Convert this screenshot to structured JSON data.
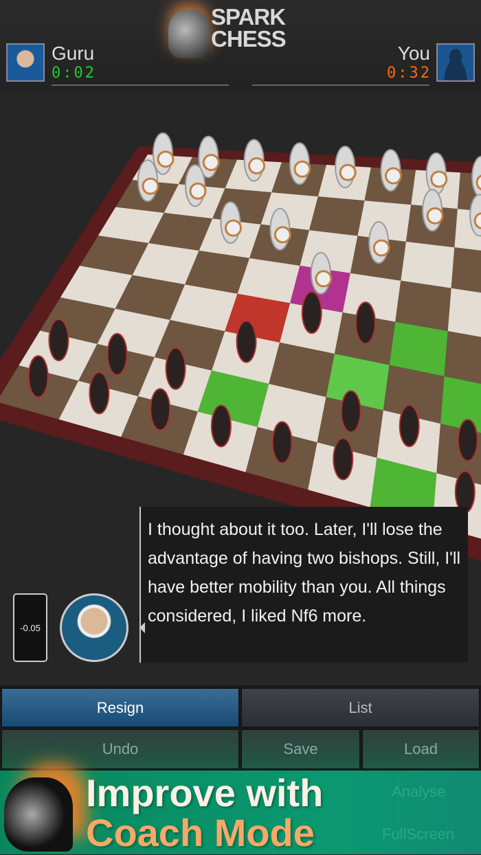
{
  "header": {
    "logo": "SPARK CHESS",
    "logo_line1": "SPARK",
    "logo_line2": "CHESS",
    "player_left": {
      "name": "Guru",
      "clock": "0:02",
      "clock_color": "#22cc22"
    },
    "player_right": {
      "name": "You",
      "clock": "0:32",
      "clock_color": "#ff6a10"
    }
  },
  "board": {
    "light": "#e3ddd3",
    "dark": "#6e5640",
    "frame": "#5a1c1c",
    "highlights": [
      {
        "sq": "d4",
        "color": "#c0362a"
      },
      {
        "sq": "e5",
        "color": "#b0348f"
      },
      {
        "sq": "g4",
        "color": "#4fb534"
      },
      {
        "sq": "h3",
        "color": "#4fb534"
      },
      {
        "sq": "f3",
        "color": "#5fc84a"
      },
      {
        "sq": "d2",
        "color": "#4fb534"
      },
      {
        "sq": "g1",
        "color": "#4fb534"
      }
    ],
    "white_pieces": [
      "a8",
      "b8",
      "c8",
      "d8",
      "e8",
      "f8",
      "g8",
      "h8",
      "a7",
      "b7",
      "g7",
      "h7",
      "f6",
      "c6",
      "d6",
      "e5"
    ],
    "black_pieces": [
      "a1",
      "b1",
      "c1",
      "d1",
      "e1",
      "f1",
      "h1",
      "a2",
      "b2",
      "c2",
      "f2",
      "g2",
      "d3",
      "f4",
      "e4",
      "h2"
    ]
  },
  "dialog": {
    "text": "I thought about it too. Later, I'll lose the advantage of having two bishops. Still, I'll have better mobility than you. All things considered, I liked Nf6 more.",
    "evaluation": "-0.05"
  },
  "buttons": {
    "resign": "Resign",
    "list": "List",
    "undo": "Undo",
    "save": "Save",
    "load": "Load",
    "analyse": "Analyse",
    "fullscreen": "FullScreen"
  },
  "banner": {
    "line1": "Improve with",
    "line2": "Coach Mode"
  }
}
